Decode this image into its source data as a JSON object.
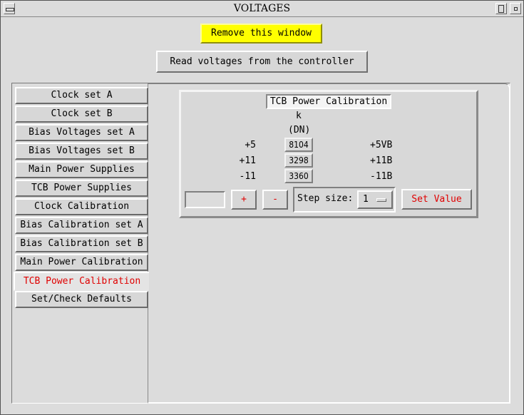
{
  "window": {
    "title": "VOLTAGES"
  },
  "buttons": {
    "remove_window": "Remove this window",
    "read_voltages": "Read voltages from the controller"
  },
  "tabs": [
    {
      "label": "Clock set A",
      "active": false
    },
    {
      "label": "Clock set B",
      "active": false
    },
    {
      "label": "Bias Voltages set A",
      "active": false
    },
    {
      "label": "Bias Voltages set B",
      "active": false
    },
    {
      "label": "Main Power Supplies",
      "active": false
    },
    {
      "label": "TCB Power Supplies",
      "active": false
    },
    {
      "label": "Clock Calibration",
      "active": false
    },
    {
      "label": "Bias Calibration set A",
      "active": false
    },
    {
      "label": "Bias Calibration set B",
      "active": false
    },
    {
      "label": "Main Power Calibration",
      "active": false
    },
    {
      "label": "TCB Power Calibration",
      "active": true
    },
    {
      "label": "Set/Check Defaults",
      "active": false
    }
  ],
  "calibration": {
    "title": "TCB Power Calibration",
    "column_header": "k",
    "column_unit": "(DN)",
    "rows": [
      {
        "left_label": "+5",
        "value": "8104",
        "right_label": "+5VB"
      },
      {
        "left_label": "+11",
        "value": "3298",
        "right_label": "+11B"
      },
      {
        "left_label": "-11",
        "value": "3360",
        "right_label": "-11B"
      }
    ],
    "entry_value": "",
    "plus_label": "+",
    "minus_label": "-",
    "step_label": "Step size:",
    "step_value": "1",
    "set_label": "Set Value"
  },
  "colors": {
    "background": "#dcdcdc",
    "remove_button": "#ffff00",
    "active_tab_text": "#e00000",
    "action_text": "#e00000"
  }
}
